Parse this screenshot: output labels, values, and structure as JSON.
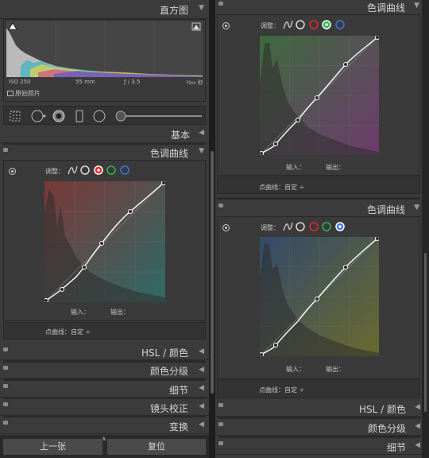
{
  "left": {
    "histogram": {
      "title": "直方图",
      "iso": "ISO 250",
      "focal": "55 mm",
      "aperture": "ƒ / 3.5",
      "shutter": "¹⁄₂₀₀ 秒",
      "original_photo_label": "原始照片"
    },
    "tool_icons": [
      "grid-crop-icon",
      "spot-removal-icon",
      "red-eye-icon",
      "graduated-filter-icon",
      "radial-filter-icon",
      "brush-slider-icon"
    ],
    "basic_label": "基本",
    "tone_curve": {
      "title": "色调曲线",
      "adjust_label": "调整：",
      "input_label": "输入：",
      "output_label": "输出：",
      "point_curve_label": "点曲线：",
      "point_curve_value": "自定 ÷",
      "active_channel": "red"
    },
    "sections": [
      "HSL / 颜色",
      "颜色分级",
      "细节",
      "镜头校正",
      "变换"
    ],
    "buttons": {
      "previous": "上一张",
      "reset": "复位"
    }
  },
  "right": {
    "top_curve": {
      "title": "色调曲线",
      "adjust_label": "调整：",
      "input_label": "输入：",
      "output_label": "输出：",
      "point_curve_label": "点曲线：",
      "point_curve_value": "自定 ÷",
      "active_channel": "green"
    },
    "bottom_curve": {
      "title": "色调曲线",
      "adjust_label": "调整：",
      "input_label": "输入：",
      "output_label": "输出：",
      "point_curve_label": "点曲线：",
      "point_curve_value": "自定 ÷",
      "active_channel": "blue"
    },
    "sections": [
      "HSL / 颜色",
      "颜色分级",
      "细节"
    ]
  },
  "colors": {
    "red": "#e8262a",
    "green": "#2fb54a",
    "blue": "#3a74e6",
    "panel_bg": "#3b3b3b",
    "curve_line": "#ffffff"
  }
}
